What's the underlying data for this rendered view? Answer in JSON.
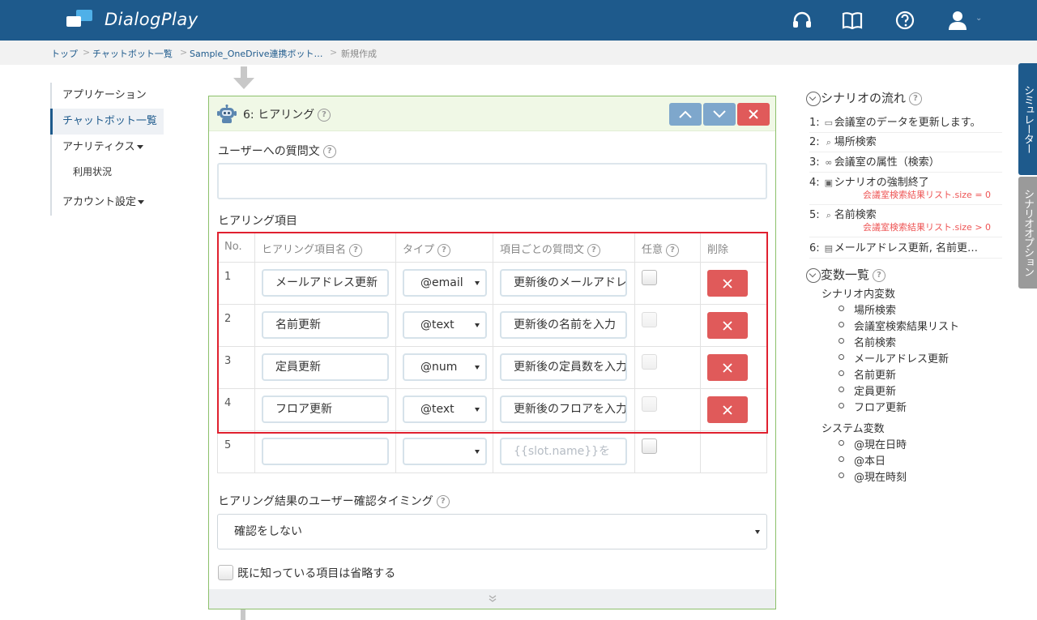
{
  "app": {
    "name": "DialogPlay"
  },
  "header_icons": [
    "headset-icon",
    "book-icon",
    "help-icon",
    "user-icon"
  ],
  "breadcrumb": {
    "items": [
      "トップ",
      "チャットボット一覧",
      "Sample_OneDrive連携ボット…",
      "新規作成"
    ],
    "sep": ">"
  },
  "sidebar": {
    "items": [
      {
        "label": "アプリケーション"
      },
      {
        "label": "チャットボット一覧"
      },
      {
        "label": "アナリティクス"
      },
      {
        "label": "利用状況"
      },
      {
        "label": "アカウント設定"
      }
    ]
  },
  "panel": {
    "title": "6: ヒアリング",
    "question_label": "ユーザーへの質問文",
    "question_value": "",
    "items_label": "ヒアリング項目",
    "columns": [
      "No.",
      "ヒアリング項目名",
      "タイプ",
      "項目ごとの質問文",
      "任意",
      "削除"
    ],
    "rows": [
      {
        "no": "1",
        "name": "メールアドレス更新",
        "type": "@email",
        "question": "更新後のメールアドレス",
        "optional": false
      },
      {
        "no": "2",
        "name": "名前更新",
        "type": "@text",
        "question": "更新後の名前を入力",
        "optional": false
      },
      {
        "no": "3",
        "name": "定員更新",
        "type": "@num",
        "question": "更新後の定員数を入力",
        "optional": false
      },
      {
        "no": "4",
        "name": "フロア更新",
        "type": "@text",
        "question": "更新後のフロアを入力",
        "optional": false
      }
    ],
    "new_row": {
      "no": "5",
      "placeholder": "{{slot.name}}を"
    },
    "confirm_label": "ヒアリング結果のユーザー確認タイミング",
    "confirm_value": "確認をしない",
    "skip_label": "既に知っている項目は省略する",
    "colors": {
      "border": "#8cc06b",
      "header_bg": "#f0f8e6",
      "highlight": "#e0202f",
      "delete": "#e05a5a",
      "move": "#7ea7cc"
    }
  },
  "scenario": {
    "title": "シナリオの流れ",
    "steps": [
      {
        "label": "1:",
        "icon": "speech-icon",
        "text": "会議室のデータを更新します。"
      },
      {
        "label": "2:",
        "icon": "search-icon",
        "text": "場所検索"
      },
      {
        "label": "3:",
        "icon": "link-icon",
        "text": "会議室の属性（検索）"
      },
      {
        "label": "4:",
        "icon": "stop-icon",
        "text": "シナリオの強制終了",
        "cond": "会議室検索結果リスト.size = 0"
      },
      {
        "label": "5:",
        "icon": "search-icon",
        "text": "名前検索",
        "cond": "会議室検索結果リスト.size > 0"
      },
      {
        "label": "6:",
        "icon": "robot-icon",
        "text": "メールアドレス更新, 名前更…"
      }
    ]
  },
  "variables": {
    "title": "変数一覧",
    "scenario_label": "シナリオ内変数",
    "scenario_vars": [
      "場所検索",
      "会議室検索結果リスト",
      "名前検索",
      "メールアドレス更新",
      "名前更新",
      "定員更新",
      "フロア更新"
    ],
    "system_label": "システム変数",
    "system_vars": [
      "@現在日時",
      "@本日",
      "@現在時刻"
    ]
  },
  "side_tabs": {
    "simulator": "シミュレーター",
    "options": "シナリオオプション"
  }
}
